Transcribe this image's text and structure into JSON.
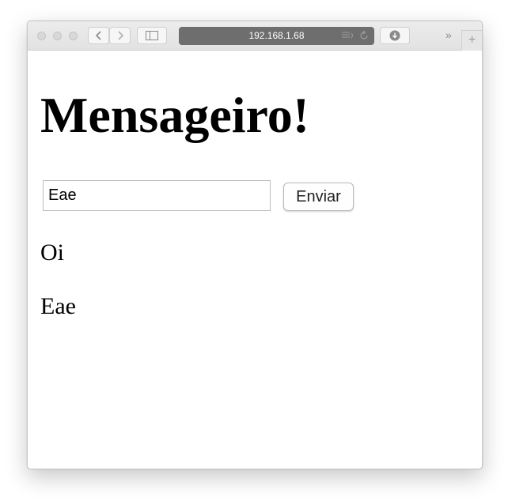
{
  "browser": {
    "address": "192.168.1.68",
    "icons": {
      "back": "chevron-left-icon",
      "forward": "chevron-right-icon",
      "sidebar": "sidebar-icon",
      "download": "download-icon",
      "more": "chevron-double-right-icon",
      "new_tab": "plus-icon"
    },
    "more_glyph": "»",
    "new_tab_glyph": "+"
  },
  "page": {
    "title": "Mensageiro!",
    "input_value": "Eae",
    "send_label": "Enviar",
    "messages": [
      "Oi",
      "Eae"
    ]
  }
}
